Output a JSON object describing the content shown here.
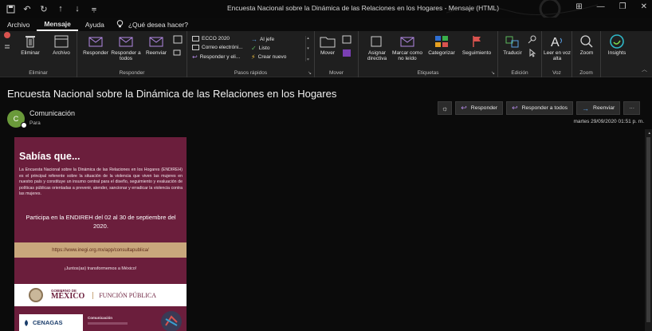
{
  "window": {
    "title": "Encuesta Nacional sobre la Dinámica de las Relaciones en los Hogares  -  Mensaje (HTML)"
  },
  "menu": {
    "tabs": [
      "Archivo",
      "Mensaje",
      "Ayuda"
    ],
    "active_tab": "Mensaje",
    "tell_me": "¿Qué desea hacer?"
  },
  "ribbon": {
    "groups": {
      "eliminar": {
        "label": "Eliminar",
        "buttons": [
          "Eliminar",
          "Archivo"
        ]
      },
      "responder": {
        "label": "Responder",
        "buttons": [
          "Responder",
          "Responder a todos",
          "Reenviar"
        ]
      },
      "pasos": {
        "label": "Pasos rápidos",
        "items": [
          "ECCO 2020",
          "Correo electróni...",
          "Responder y eli...",
          "Al jefe",
          "Listo",
          "Crear nuevo"
        ]
      },
      "mover": {
        "label": "Mover",
        "buttons": [
          "Mover"
        ]
      },
      "etiquetas": {
        "label": "Etiquetas",
        "buttons": [
          "Asignar directiva",
          "Marcar como no leído",
          "Categorizar",
          "Seguimiento"
        ]
      },
      "edicion": {
        "label": "Edición",
        "buttons": [
          "Traducir"
        ]
      },
      "voz": {
        "label": "Voz",
        "buttons": [
          "Leer en voz alta"
        ]
      },
      "zoom": {
        "label": "Zoom",
        "buttons": [
          "Zoom"
        ]
      },
      "insights": {
        "buttons": [
          "Insights"
        ]
      }
    }
  },
  "message": {
    "subject": "Encuesta Nacional sobre la Dinámica de las Relaciones en los Hogares",
    "avatar_letter": "C",
    "sender": "Comunicación",
    "to_label": "Para",
    "datetime": "martes 29/09/2020 01:51 p. m.",
    "actions": {
      "reply": "Responder",
      "reply_all": "Responder a todos",
      "forward": "Reenviar",
      "more": "···"
    }
  },
  "banner": {
    "heading": "Sabías que...",
    "paragraph": "La Encuesta Nacional sobre la Dinámica de las Relaciones en los Hogares (ENDIREH) es el principal referente sobre la situación de la violencia que viven las mujeres en nuestro país y constituye un insumo central para el diseño, seguimiento y evaluación de políticas públicas orientadas a prevenir, atender, sancionar y erradicar la violencia contra las mujeres.",
    "cta": "Participa en la ENDIREH del 02 al 30 de septiembre del 2020.",
    "url": "https://www.inegi.org.mx/app/consultapublica/",
    "juntos": "¡Juntos(as) transformemos a México!",
    "gob_small": "GOBIERNO DE",
    "gob_big": "MÉXICO",
    "funcion": "FUNCIÓN PÚBLICA",
    "cenagas": "CENAGAS",
    "comunicacion": "Comunicación"
  },
  "colors": {
    "banner_bg": "#6b1e3c",
    "banner_accent": "#c9a77c",
    "avatar_bg": "#6a9a3a",
    "link_blue": "#5aa0e6"
  }
}
